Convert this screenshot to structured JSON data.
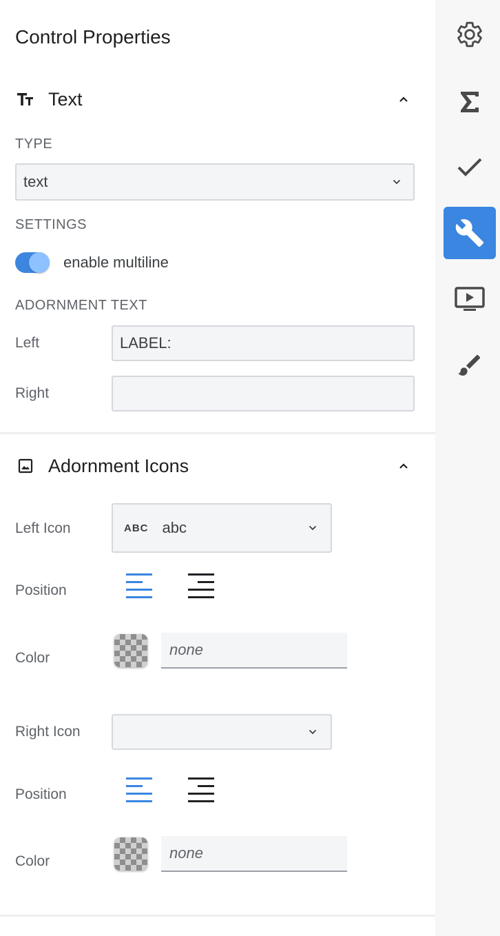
{
  "panel": {
    "title": "Control Properties"
  },
  "text_section": {
    "title": "Text",
    "icon": "text-fields-icon",
    "type_label": "TYPE",
    "type_value": "text",
    "settings_label": "SETTINGS",
    "multiline_label": "enable multiline",
    "multiline_enabled": true,
    "adornment_label": "ADORNMENT TEXT",
    "left_label": "Left",
    "left_value": "LABEL:",
    "right_label": "Right",
    "right_value": ""
  },
  "icons_section": {
    "title": "Adornment Icons",
    "icon": "image-icon",
    "left_icon_label": "Left Icon",
    "left_icon_badge": "ABC",
    "left_icon_value": "abc",
    "left_position_label": "Position",
    "left_color_label": "Color",
    "left_color_placeholder": "none",
    "right_icon_label": "Right Icon",
    "right_icon_value": "",
    "right_position_label": "Position",
    "right_color_label": "Color",
    "right_color_placeholder": "none"
  },
  "rail": {
    "items": [
      "gear-icon",
      "sigma-icon",
      "check-icon",
      "wrench-icon",
      "preview-icon",
      "brush-icon"
    ],
    "active": "wrench-icon"
  },
  "colors": {
    "accent": "#3a86e0",
    "align_active": "#3a86e0",
    "align_inactive": "#202124"
  }
}
